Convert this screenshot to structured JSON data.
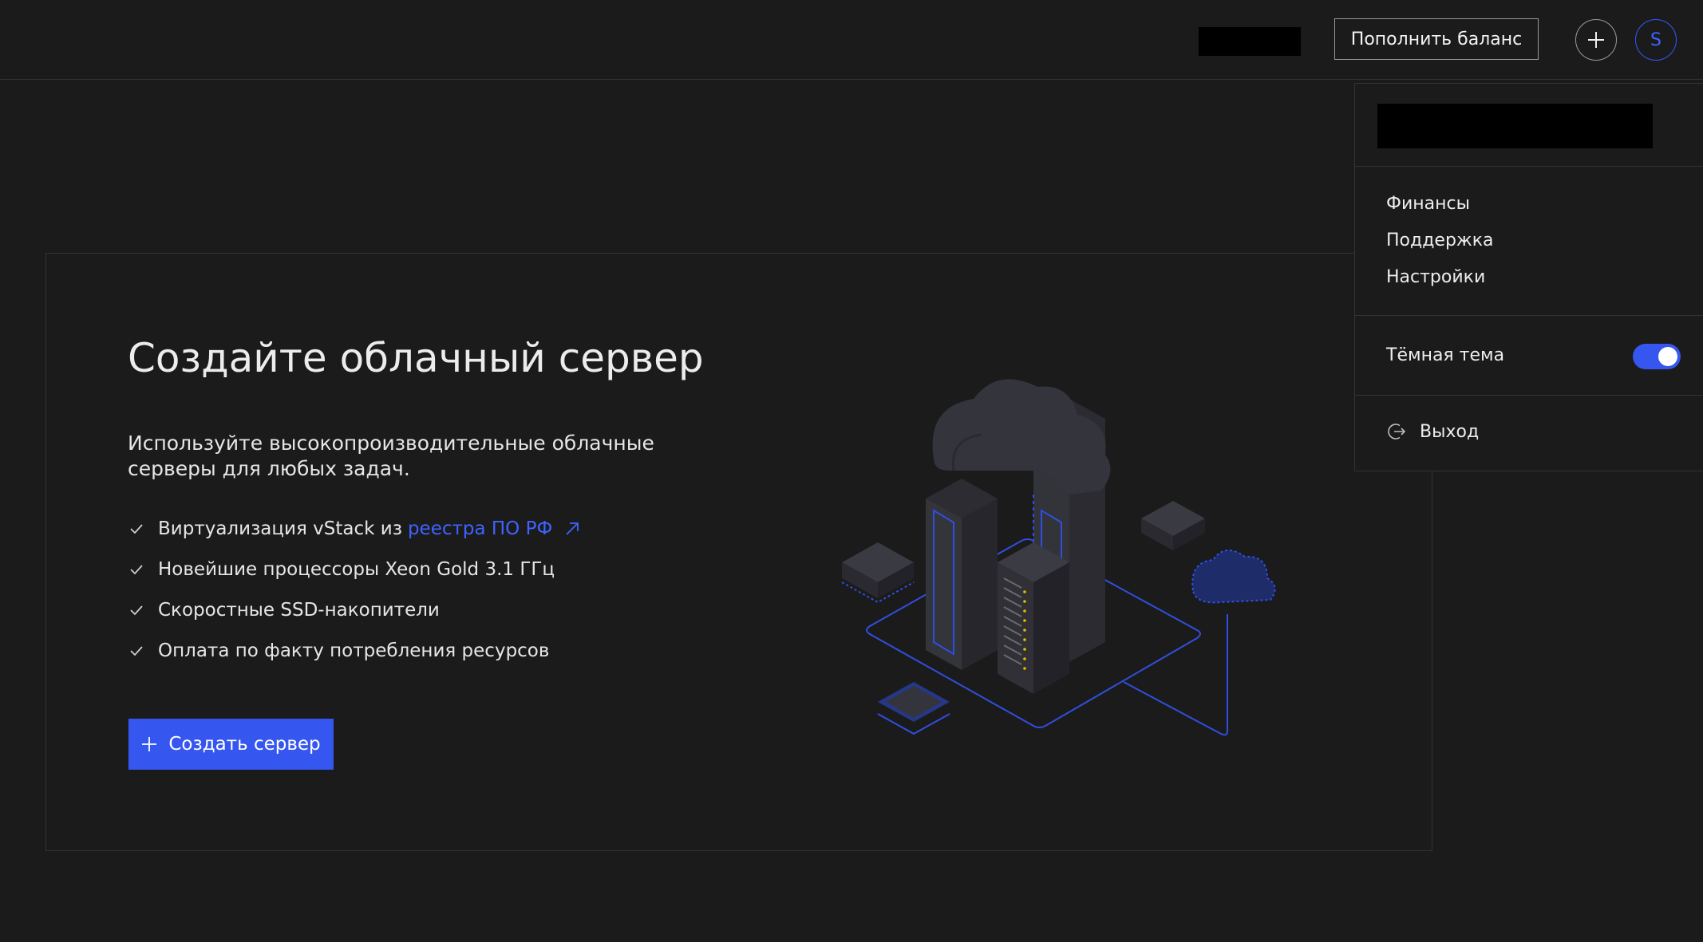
{
  "header": {
    "topup_label": "Пополнить баланс",
    "avatar_initial": "S"
  },
  "hero": {
    "title": "Создайте облачный сервер",
    "subtitle": "Используйте высокопроизводительные облачные серверы для любых задач.",
    "features": [
      {
        "text": "Виртуализация vStack из",
        "link": "реестра ПО РФ"
      },
      {
        "text": "Новейшие процессоры Xeon Gold 3.1 ГГц"
      },
      {
        "text": "Скоростные SSD-накопители"
      },
      {
        "text": "Оплата по факту потребления ресурсов"
      }
    ],
    "create_label": "Создать сервер"
  },
  "user_menu": {
    "items": [
      "Финансы",
      "Поддержка",
      "Настройки"
    ],
    "dark_theme_label": "Тёмная тема",
    "dark_theme_on": true,
    "logout_label": "Выход"
  },
  "colors": {
    "accent": "#3656f0",
    "background": "#1b1b1b",
    "link": "#3f63ff"
  },
  "icons": [
    "plus-icon",
    "check-icon",
    "external-link-icon",
    "logout-icon"
  ]
}
